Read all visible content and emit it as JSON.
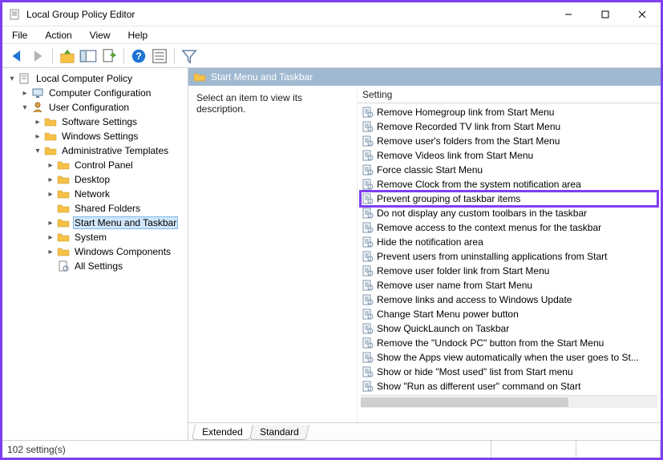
{
  "window": {
    "title": "Local Group Policy Editor"
  },
  "menubar": {
    "file": "File",
    "action": "Action",
    "view": "View",
    "help": "Help"
  },
  "tree": {
    "root": "Local Computer Policy",
    "computer_config": "Computer Configuration",
    "user_config": "User Configuration",
    "software_settings": "Software Settings",
    "windows_settings": "Windows Settings",
    "admin_templates": "Administrative Templates",
    "control_panel": "Control Panel",
    "desktop": "Desktop",
    "network": "Network",
    "shared_folders": "Shared Folders",
    "start_menu_taskbar": "Start Menu and Taskbar",
    "system": "System",
    "windows_components": "Windows Components",
    "all_settings": "All Settings"
  },
  "header": {
    "path": "Start Menu and Taskbar"
  },
  "description": {
    "placeholder": "Select an item to view its description."
  },
  "list": {
    "column_header": "Setting",
    "items": [
      "Remove Homegroup link from Start Menu",
      "Remove Recorded TV link from Start Menu",
      "Remove user's folders from the Start Menu",
      "Remove Videos link from Start Menu",
      "Force classic Start Menu",
      "Remove Clock from the system notification area",
      "Prevent grouping of taskbar items",
      "Do not display any custom toolbars in the taskbar",
      "Remove access to the context menus for the taskbar",
      "Hide the notification area",
      "Prevent users from uninstalling applications from Start",
      "Remove user folder link from Start Menu",
      "Remove user name from Start Menu",
      "Remove links and access to Windows Update",
      "Change Start Menu power button",
      "Show QuickLaunch on Taskbar",
      "Remove the \"Undock PC\" button from the Start Menu",
      "Show the Apps view automatically when the user goes to St...",
      "Show or hide \"Most used\" list from Start menu",
      "Show \"Run as different user\" command on Start"
    ],
    "highlighted_index": 6
  },
  "tabs": {
    "extended": "Extended",
    "standard": "Standard"
  },
  "statusbar": {
    "text": "102 setting(s)"
  }
}
